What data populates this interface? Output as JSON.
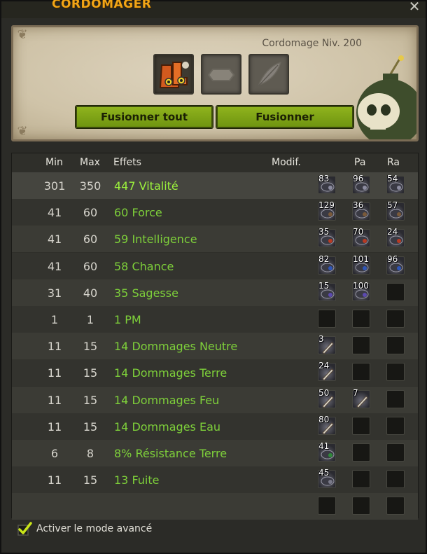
{
  "window": {
    "title": "CORDOMAGER",
    "close_glyph": "✕"
  },
  "header": {
    "job_level": "Cordomage Niv. 200",
    "slots": [
      {
        "icon": "boots-item-icon"
      },
      {
        "icon": "empty-rune-slot-icon"
      },
      {
        "icon": "feather-slot-icon"
      }
    ],
    "buttons": {
      "merge_all": "Fusionner tout",
      "merge": "Fusionner"
    }
  },
  "table": {
    "columns": {
      "min": "Min",
      "max": "Max",
      "effects": "Effets",
      "modif": "Modif.",
      "pa": "Pa",
      "ra": "Ra"
    },
    "rows": [
      {
        "min": "301",
        "max": "350",
        "effect": "447 Vitalité",
        "runes": [
          "83",
          "96",
          "54"
        ]
      },
      {
        "min": "41",
        "max": "60",
        "effect": "60 Force",
        "runes": [
          "129",
          "36",
          "57"
        ]
      },
      {
        "min": "41",
        "max": "60",
        "effect": "59 Intelligence",
        "runes": [
          "35",
          "70",
          "24"
        ]
      },
      {
        "min": "41",
        "max": "60",
        "effect": "58 Chance",
        "runes": [
          "82",
          "101",
          "96"
        ]
      },
      {
        "min": "31",
        "max": "40",
        "effect": "35 Sagesse",
        "runes": [
          "15",
          "100",
          ""
        ]
      },
      {
        "min": "1",
        "max": "1",
        "effect": "1 PM",
        "runes": [
          "",
          "",
          ""
        ]
      },
      {
        "min": "11",
        "max": "15",
        "effect": "14 Dommages Neutre",
        "runes": [
          "3",
          "",
          ""
        ]
      },
      {
        "min": "11",
        "max": "15",
        "effect": "14 Dommages Terre",
        "runes": [
          "24",
          "",
          ""
        ]
      },
      {
        "min": "11",
        "max": "15",
        "effect": "14 Dommages Feu",
        "runes": [
          "50",
          "7",
          ""
        ]
      },
      {
        "min": "11",
        "max": "15",
        "effect": "14 Dommages Eau",
        "runes": [
          "80",
          "",
          ""
        ]
      },
      {
        "min": "6",
        "max": "8",
        "effect": "8% Résistance Terre",
        "runes": [
          "41",
          "",
          ""
        ]
      },
      {
        "min": "11",
        "max": "15",
        "effect": "13 Fuite",
        "runes": [
          "45",
          "",
          ""
        ]
      },
      {
        "min": "",
        "max": "",
        "effect": "",
        "runes": [
          "",
          "",
          ""
        ]
      }
    ]
  },
  "footer": {
    "advanced_mode_label": "Activer le mode avancé",
    "advanced_mode_checked": true
  },
  "colors": {
    "accent_title": "#f2a516",
    "button_green": "#8fb31d",
    "effect_green": "#7ed03a"
  }
}
